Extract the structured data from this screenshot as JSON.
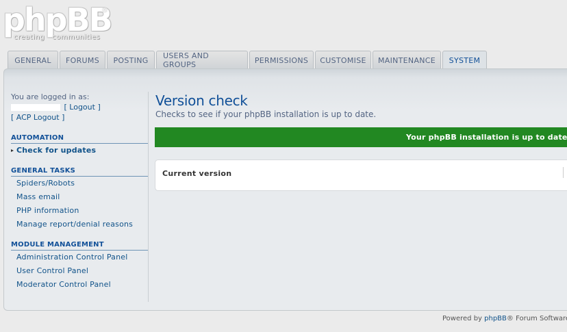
{
  "logo": {
    "wordmark": "phpBB",
    "registered": "®",
    "tagline": "creating   communities"
  },
  "tabs": [
    {
      "label": "GENERAL"
    },
    {
      "label": "FORUMS"
    },
    {
      "label": "POSTING"
    },
    {
      "label": "USERS AND GROUPS"
    },
    {
      "label": "PERMISSIONS"
    },
    {
      "label": "CUSTOMISE"
    },
    {
      "label": "MAINTENANCE"
    },
    {
      "label": "SYSTEM",
      "active": true
    }
  ],
  "sidebar": {
    "logged_in_label": "You are logged in as:",
    "logout": "[ Logout ]",
    "acp_logout": "[ ACP Logout ]",
    "sections": [
      {
        "heading": "AUTOMATION",
        "items": [
          "Check for updates"
        ]
      },
      {
        "heading": "GENERAL TASKS",
        "items": [
          "Spiders/Robots",
          "Mass email",
          "PHP information",
          "Manage report/denial reasons"
        ]
      },
      {
        "heading": "MODULE MANAGEMENT",
        "items": [
          "Administration Control Panel",
          "User Control Panel",
          "Moderator Control Panel"
        ]
      }
    ]
  },
  "main": {
    "title": "Version check",
    "description": "Checks to see if your phpBB installation is up to date.",
    "success_message": "Your phpBB installation is up to date. The",
    "current_version_label": "Current version"
  },
  "footer": {
    "prefix": "Powered by ",
    "link": "phpBB",
    "suffix": "® Forum Software"
  },
  "colors": {
    "success": "#228822",
    "link": "#105289",
    "heading": "#115098",
    "text": "#536482"
  }
}
